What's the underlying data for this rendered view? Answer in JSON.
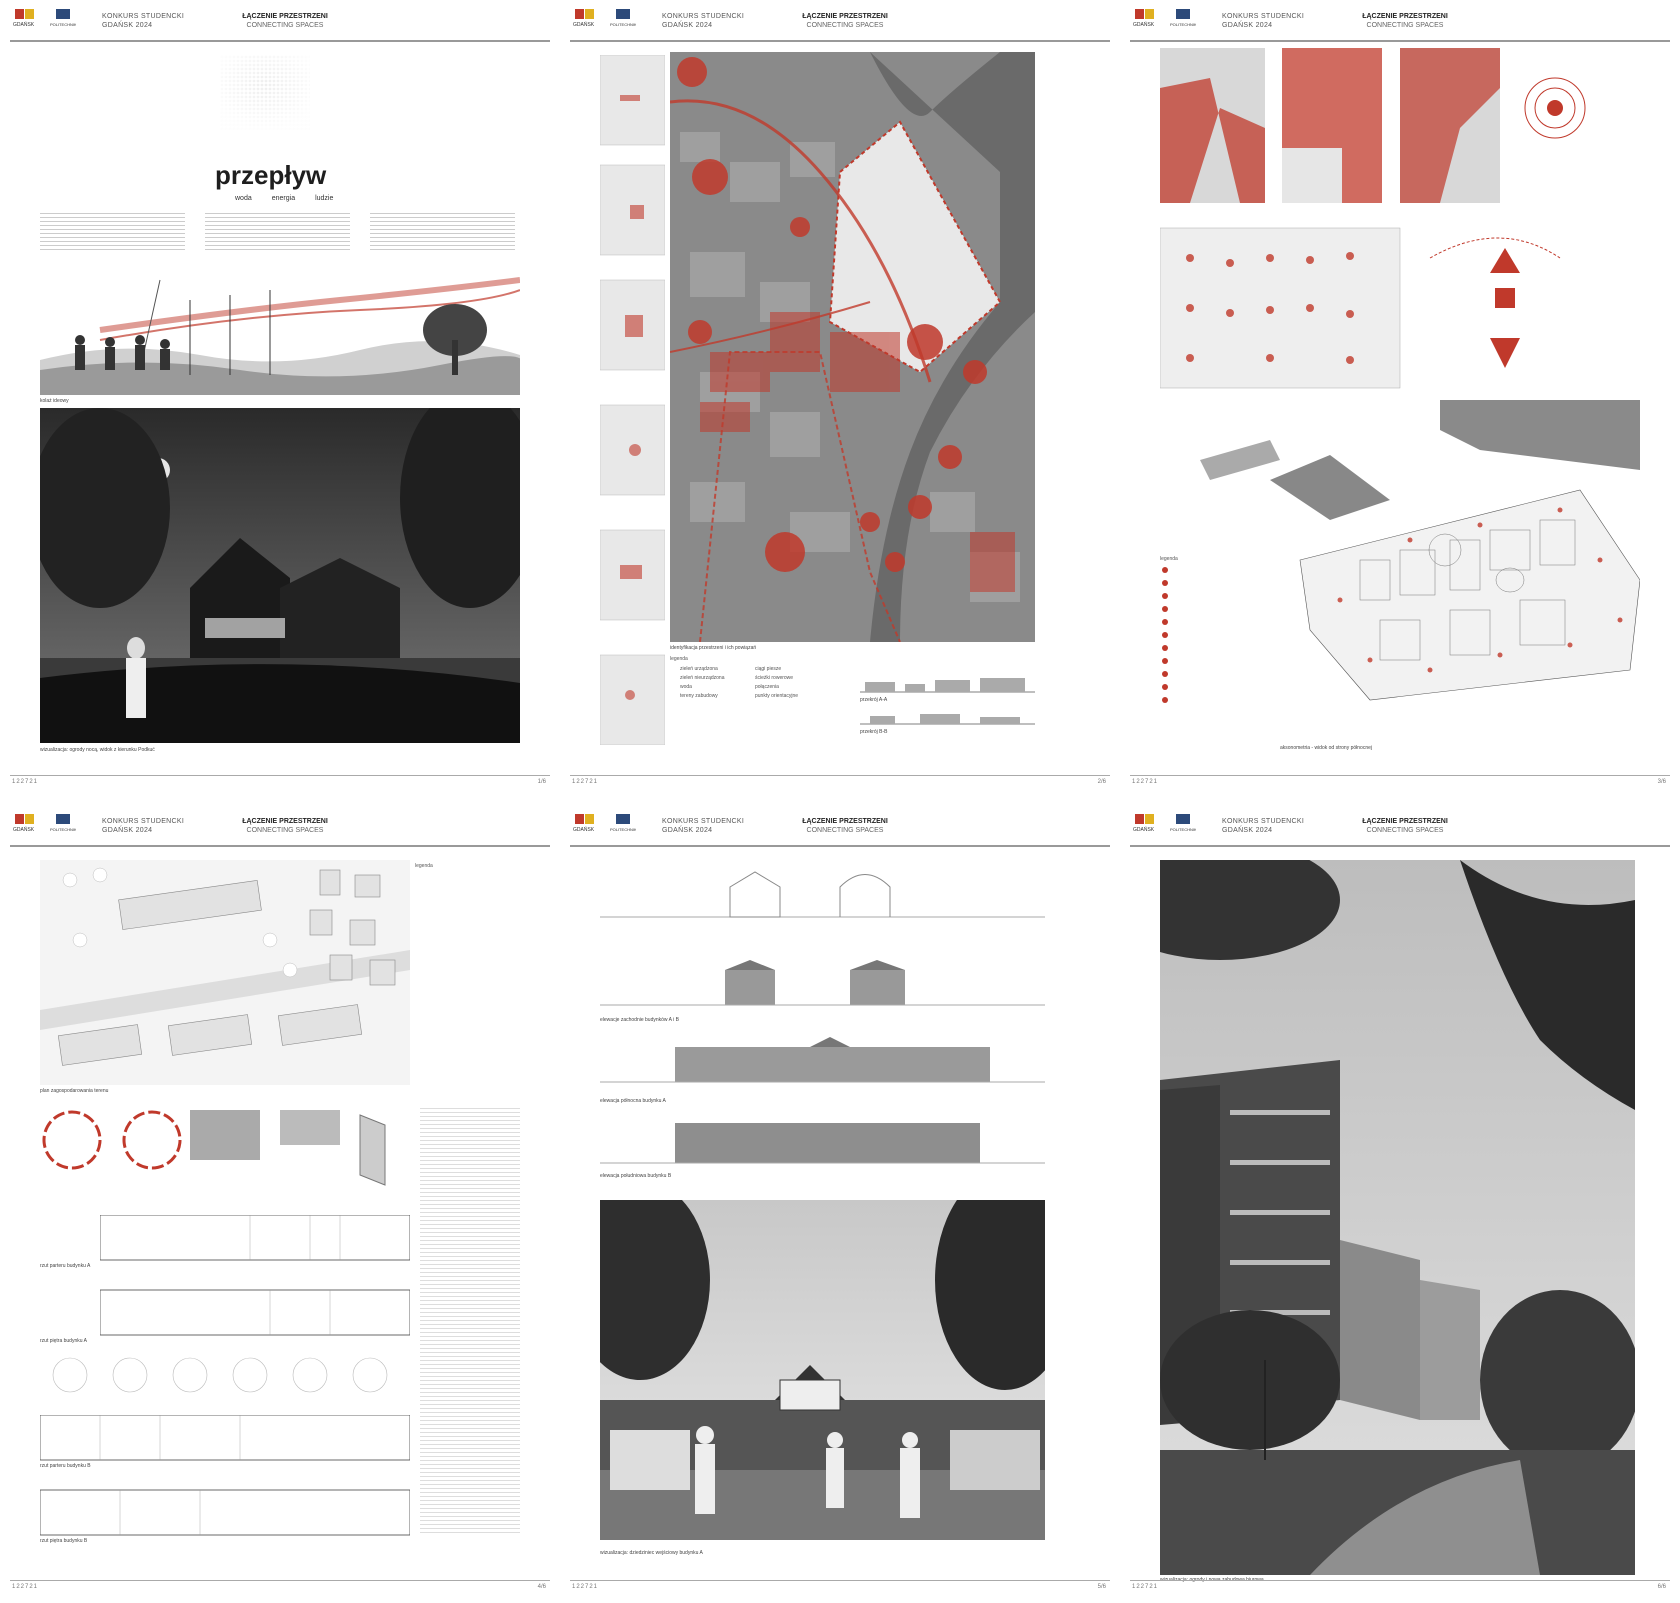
{
  "header": {
    "contest_line1": "KONKURS STUDENCKI",
    "contest_line2": "GDAŃSK 2024",
    "title_pl": "ŁĄCZENIE PRZESTRZENI",
    "title_en": "CONNECTING SPACES"
  },
  "footer": {
    "code": "122721",
    "pages": [
      "1/6",
      "2/6",
      "3/6",
      "4/6",
      "5/6",
      "6/6"
    ]
  },
  "board1": {
    "brand": "przepływ",
    "tags": [
      "woda",
      "energia",
      "ludzie"
    ],
    "caption_panorama": "kolaż ideowy",
    "caption_render": "wizualizacja: ogrody nocą, widok z kierunku Podkuć"
  },
  "board2": {
    "caption_map": "identyfikacja przestrzeni i ich powiązań",
    "legend_title": "legenda",
    "legend_items": [
      "zieleń urządzona",
      "zieleń nieurządzona",
      "woda",
      "tereny zabudowy",
      "ciągi piesze",
      "ścieżki rowerowe",
      "połączenia",
      "punkty orientacyjne"
    ],
    "sections": [
      "przekrój A-A",
      "przekrój B-B"
    ]
  },
  "board3": {
    "caption_axon": "aksonometria - widok od strony północnej",
    "legend_title": "legenda"
  },
  "board4": {
    "caption_plan": "plan zagospodarowania terenu",
    "caption_floor1": "rzut parteru budynku A",
    "caption_floor2": "rzut piętra budynku A",
    "caption_floor3": "rzut parteru budynku B",
    "caption_floor4": "rzut piętra budynku B",
    "legend_title": "legenda"
  },
  "board5": {
    "caption_elev1": "elewacje zachodnie budynków A i B",
    "caption_elev2": "elewacja północna budynku A",
    "caption_elev3": "elewacja południowa budynku B",
    "caption_render": "wizualizacja: dziedziniec wejściowy budynku A"
  },
  "board6": {
    "caption_render": "wizualizacja: ogrody i nowa zabudowa biurowa"
  }
}
